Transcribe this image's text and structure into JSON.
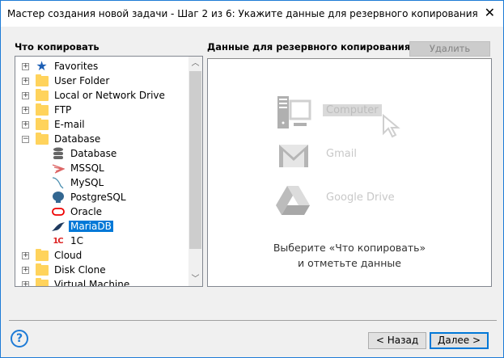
{
  "window": {
    "title": "Мастер создания новой задачи - Шаг 2 из 6: Укажите данные для резервного копирования",
    "accent": "#1e7bd6"
  },
  "left": {
    "label": "Что копировать",
    "items": [
      {
        "label": "Favorites",
        "icon": "star-icon",
        "expander": "+"
      },
      {
        "label": "User Folder",
        "icon": "folder-icon",
        "expander": "+"
      },
      {
        "label": "Local or Network Drive",
        "icon": "folder-icon",
        "expander": "+"
      },
      {
        "label": "FTP",
        "icon": "folder-icon",
        "expander": "+"
      },
      {
        "label": "E-mail",
        "icon": "folder-icon",
        "expander": "+"
      },
      {
        "label": "Database",
        "icon": "folder-icon",
        "expander": "−"
      },
      {
        "label": "Database",
        "icon": "database-icon",
        "child": true
      },
      {
        "label": "MSSQL",
        "icon": "mssql-icon",
        "child": true
      },
      {
        "label": "MySQL",
        "icon": "mysql-icon",
        "child": true
      },
      {
        "label": "PostgreSQL",
        "icon": "postgresql-icon",
        "child": true
      },
      {
        "label": "Oracle",
        "icon": "oracle-icon",
        "child": true
      },
      {
        "label": "MariaDB",
        "icon": "mariadb-icon",
        "child": true,
        "selected": true
      },
      {
        "label": "1C",
        "icon": "1c-icon",
        "child": true
      },
      {
        "label": "Cloud",
        "icon": "folder-icon",
        "expander": "+"
      },
      {
        "label": "Disk Clone",
        "icon": "folder-icon",
        "expander": "+"
      },
      {
        "label": "Virtual Machine",
        "icon": "folder-icon",
        "expander": "+"
      }
    ]
  },
  "right": {
    "label": "Данные для резервного копирования",
    "delete_label": "Удалить",
    "services": [
      "Computer",
      "Gmail",
      "Google Drive"
    ],
    "hint_line1": "Выберите «Что копировать»",
    "hint_line2": "и отметьте данные"
  },
  "footer": {
    "help": "?",
    "back_label": "< Назад",
    "next_label": "Далее >"
  }
}
